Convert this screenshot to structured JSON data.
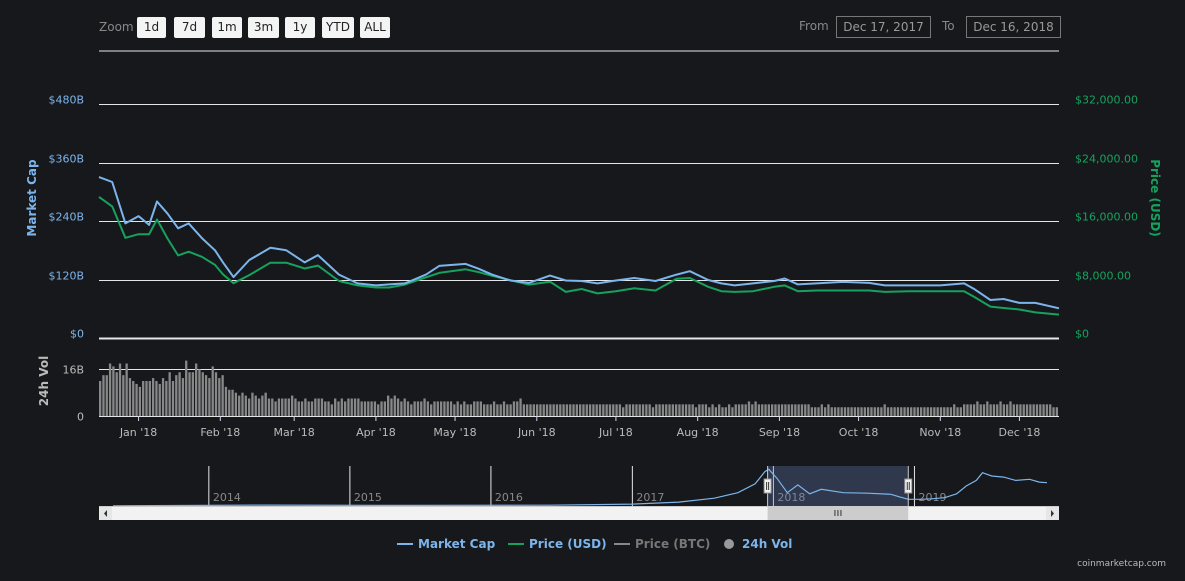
{
  "toolbar": {
    "zoom_label": "Zoom",
    "zoom_buttons": [
      "1d",
      "7d",
      "1m",
      "3m",
      "1y",
      "YTD",
      "ALL"
    ],
    "from_label": "From",
    "to_label": "To",
    "from_value": "Dec 17, 2017",
    "to_value": "Dec 16, 2018"
  },
  "chart_data": {
    "type": "line",
    "x_range": [
      "2017-12-17",
      "2018-12-16"
    ],
    "x_tick_labels": [
      "Jan '18",
      "Feb '18",
      "Mar '18",
      "Apr '18",
      "May '18",
      "Jun '18",
      "Jul '18",
      "Aug '18",
      "Sep '18",
      "Oct '18",
      "Nov '18",
      "Dec '18"
    ],
    "left_axis": {
      "title": "Market Cap",
      "ticks": [
        "$0",
        "$120B",
        "$240B",
        "$360B",
        "$480B"
      ],
      "range": [
        0,
        480
      ]
    },
    "right_axis": {
      "title": "Price (USD)",
      "ticks": [
        "$0",
        "$8,000.00",
        "$16,000.00",
        "$24,000.00",
        "$32,000.00"
      ],
      "range": [
        0,
        32000
      ]
    },
    "vol_axis": {
      "title": "24h Vol",
      "ticks": [
        "0",
        "16B"
      ],
      "range": [
        0,
        24
      ]
    },
    "series": [
      {
        "name": "Market Cap",
        "color": "#7cb5ec",
        "unit": "billion USD",
        "x": [
          "2017-12-17",
          "2017-12-22",
          "2017-12-27",
          "2018-01-01",
          "2018-01-05",
          "2018-01-08",
          "2018-01-12",
          "2018-01-16",
          "2018-01-20",
          "2018-01-25",
          "2018-01-30",
          "2018-02-02",
          "2018-02-06",
          "2018-02-12",
          "2018-02-20",
          "2018-02-26",
          "2018-03-05",
          "2018-03-10",
          "2018-03-18",
          "2018-03-25",
          "2018-04-01",
          "2018-04-06",
          "2018-04-12",
          "2018-04-20",
          "2018-04-25",
          "2018-05-05",
          "2018-05-10",
          "2018-05-15",
          "2018-05-22",
          "2018-05-29",
          "2018-06-06",
          "2018-06-12",
          "2018-06-18",
          "2018-06-24",
          "2018-07-01",
          "2018-07-08",
          "2018-07-16",
          "2018-07-24",
          "2018-07-29",
          "2018-08-05",
          "2018-08-10",
          "2018-08-15",
          "2018-08-22",
          "2018-08-30",
          "2018-09-03",
          "2018-09-08",
          "2018-09-15",
          "2018-09-25",
          "2018-10-05",
          "2018-10-11",
          "2018-10-20",
          "2018-11-01",
          "2018-11-10",
          "2018-11-14",
          "2018-11-20",
          "2018-11-25",
          "2018-12-01",
          "2018-12-07",
          "2018-12-16"
        ],
        "values": [
          330,
          320,
          235,
          250,
          232,
          280,
          255,
          225,
          235,
          205,
          180,
          155,
          125,
          160,
          185,
          180,
          155,
          170,
          130,
          112,
          108,
          110,
          112,
          130,
          148,
          152,
          142,
          130,
          118,
          113,
          128,
          118,
          117,
          112,
          118,
          123,
          117,
          130,
          137,
          119,
          112,
          108,
          112,
          117,
          122,
          110,
          112,
          115,
          113,
          108,
          108,
          108,
          112,
          100,
          78,
          80,
          72,
          72,
          61
        ]
      },
      {
        "name": "Price (USD)",
        "color": "#16a25e",
        "unit": "USD",
        "x": [
          "2017-12-17",
          "2017-12-22",
          "2017-12-27",
          "2018-01-01",
          "2018-01-05",
          "2018-01-08",
          "2018-01-12",
          "2018-01-16",
          "2018-01-20",
          "2018-01-25",
          "2018-01-30",
          "2018-02-02",
          "2018-02-06",
          "2018-02-12",
          "2018-02-20",
          "2018-02-26",
          "2018-03-05",
          "2018-03-10",
          "2018-03-18",
          "2018-03-25",
          "2018-04-01",
          "2018-04-06",
          "2018-04-12",
          "2018-04-20",
          "2018-04-25",
          "2018-05-05",
          "2018-05-10",
          "2018-05-15",
          "2018-05-22",
          "2018-05-29",
          "2018-06-06",
          "2018-06-12",
          "2018-06-18",
          "2018-06-24",
          "2018-07-01",
          "2018-07-08",
          "2018-07-16",
          "2018-07-24",
          "2018-07-29",
          "2018-08-05",
          "2018-08-10",
          "2018-08-15",
          "2018-08-22",
          "2018-08-30",
          "2018-09-03",
          "2018-09-08",
          "2018-09-15",
          "2018-09-25",
          "2018-10-05",
          "2018-10-11",
          "2018-10-20",
          "2018-11-01",
          "2018-11-10",
          "2018-11-14",
          "2018-11-20",
          "2018-11-25",
          "2018-12-01",
          "2018-12-07",
          "2018-12-16"
        ],
        "values": [
          19300,
          18000,
          13700,
          14200,
          14200,
          16200,
          13600,
          11300,
          11800,
          11100,
          10000,
          8700,
          7500,
          8600,
          10300,
          10300,
          9500,
          9900,
          7800,
          7200,
          6900,
          6900,
          7300,
          8300,
          8900,
          9400,
          9000,
          8500,
          7900,
          7300,
          7700,
          6300,
          6700,
          6100,
          6400,
          6800,
          6500,
          8100,
          8200,
          7000,
          6400,
          6300,
          6400,
          7000,
          7200,
          6400,
          6500,
          6500,
          6500,
          6300,
          6400,
          6400,
          6400,
          5600,
          4300,
          4100,
          3900,
          3500,
          3200
        ]
      }
    ],
    "volume": {
      "name": "24h Vol",
      "color": "#888888",
      "unit": "billion USD",
      "values": [
        12,
        14,
        14,
        18,
        17,
        15,
        18,
        14,
        18,
        13,
        12,
        11,
        10,
        12,
        12,
        12,
        13,
        12,
        11,
        13,
        12,
        15,
        12,
        14,
        15,
        13,
        19,
        15,
        15,
        18,
        16,
        15,
        14,
        13,
        17,
        15,
        13,
        14,
        10,
        9,
        9,
        8,
        7,
        8,
        7,
        6,
        8,
        7,
        6,
        7,
        8,
        6,
        6,
        5,
        6,
        6,
        6,
        6,
        7,
        6,
        5,
        5,
        6,
        5,
        5,
        6,
        6,
        6,
        5,
        5,
        4,
        6,
        5,
        6,
        5,
        6,
        6,
        6,
        6,
        5,
        5,
        5,
        5,
        5,
        4,
        5,
        5,
        7,
        6,
        7,
        6,
        5,
        6,
        5,
        4,
        5,
        5,
        5,
        6,
        5,
        4,
        5,
        5,
        5,
        5,
        5,
        5,
        4,
        5,
        4,
        5,
        4,
        4,
        5,
        5,
        5,
        4,
        4,
        4,
        5,
        4,
        4,
        5,
        4,
        4,
        5,
        5,
        6,
        4,
        4,
        4,
        4,
        4,
        4,
        4,
        4,
        4,
        4,
        4,
        4,
        4,
        4,
        4,
        4,
        4,
        4,
        4,
        4,
        4,
        4,
        4,
        4,
        4,
        4,
        4,
        4,
        4,
        4,
        3,
        4,
        4,
        4,
        4,
        4,
        4,
        4,
        4,
        3,
        4,
        4,
        4,
        4,
        4,
        4,
        4,
        4,
        4,
        4,
        4,
        4,
        3,
        4,
        4,
        4,
        3,
        4,
        3,
        4,
        3,
        3,
        4,
        3,
        4,
        4,
        4,
        4,
        5,
        4,
        5,
        4,
        4,
        4,
        4,
        4,
        4,
        4,
        4,
        4,
        4,
        4,
        4,
        4,
        4,
        4,
        4,
        3,
        3,
        3,
        4,
        3,
        4,
        3,
        3,
        3,
        3,
        3,
        3,
        3,
        3,
        3,
        3,
        3,
        3,
        3,
        3,
        3,
        3,
        4,
        3,
        3,
        3,
        3,
        3,
        3,
        3,
        3,
        3,
        3,
        3,
        3,
        3,
        3,
        3,
        3,
        3,
        3,
        3,
        3,
        4,
        3,
        3,
        4,
        4,
        4,
        4,
        5,
        4,
        4,
        5,
        4,
        4,
        4,
        5,
        4,
        4,
        5,
        4,
        4,
        4,
        4,
        4,
        4,
        4,
        4,
        4,
        4,
        4,
        4,
        3,
        3
      ]
    },
    "navigator": {
      "year_labels": [
        "2014",
        "2015",
        "2016",
        "2017",
        "2018",
        "2019"
      ],
      "series_x": [
        "2013-04-28",
        "2014-06-01",
        "2015-06-01",
        "2016-06-01",
        "2017-01-01",
        "2017-05-01",
        "2017-08-01",
        "2017-10-01",
        "2017-11-15",
        "2017-12-10",
        "2017-12-20",
        "2018-01-10",
        "2018-02-06",
        "2018-03-05",
        "2018-04-05",
        "2018-05-05",
        "2018-07-01",
        "2018-09-01",
        "2018-11-01",
        "2018-11-25",
        "2018-12-16",
        "2019-01-15",
        "2019-02-15",
        "2019-03-20",
        "2019-04-20",
        "2019-05-15",
        "2019-06-10",
        "2019-06-26",
        "2019-07-20",
        "2019-08-20",
        "2019-09-20",
        "2019-10-26",
        "2019-11-20",
        "2019-12-10"
      ],
      "series_values": [
        2,
        8,
        5,
        7,
        17,
        35,
        70,
        120,
        200,
        310,
        330,
        250,
        120,
        190,
        110,
        150,
        120,
        115,
        105,
        80,
        60,
        60,
        65,
        75,
        110,
        180,
        230,
        300,
        270,
        260,
        230,
        240,
        215,
        210
      ],
      "range": [
        0,
        360
      ],
      "selected_range": [
        "2017-12-17",
        "2018-12-16"
      ]
    },
    "legend": [
      {
        "label": "Market Cap",
        "color": "#7cb5ec",
        "symbol": "line"
      },
      {
        "label": "Price (USD)",
        "color": "#16a25e",
        "symbol": "line"
      },
      {
        "label": "Price (BTC)",
        "color": "#888888",
        "symbol": "line"
      },
      {
        "label": "24h Vol",
        "color": "#888888",
        "symbol": "dot"
      }
    ]
  },
  "footer": {
    "credit": "coinmarketcap.com"
  }
}
